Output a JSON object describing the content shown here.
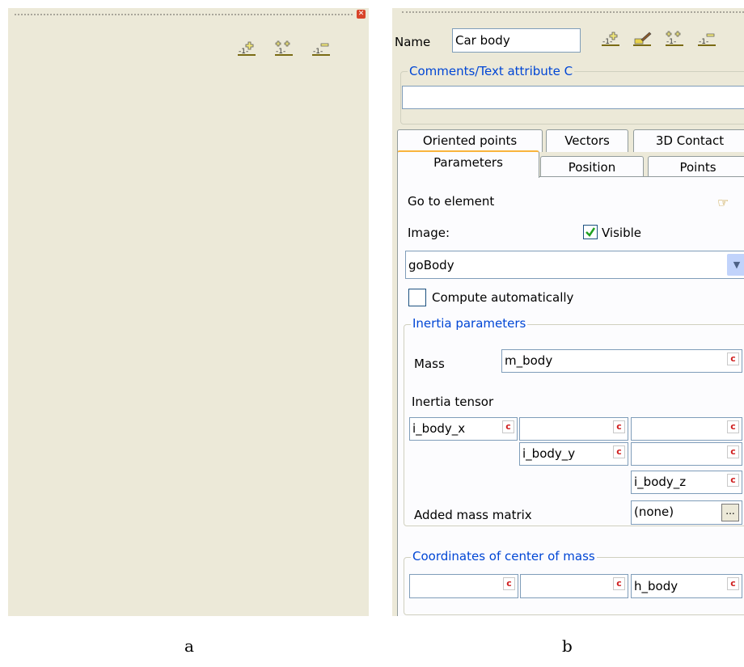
{
  "panel_a": {
    "icons": [
      "add-element-icon",
      "add-multiple-icon",
      "remove-element-icon"
    ]
  },
  "panel_b": {
    "name_label": "Name",
    "name_value": "Car body",
    "icons": [
      "add-element-icon",
      "edit-brush-icon",
      "add-multiple-icon",
      "remove-element-icon"
    ],
    "comments_title": "Comments/Text attribute C",
    "comments_value": "",
    "tabs_row1": [
      "Oriented points",
      "Vectors",
      "3D Contact"
    ],
    "tabs_row2": [
      "Parameters",
      "Position",
      "Points"
    ],
    "active_tab": "Parameters",
    "go_to_element": "Go to element",
    "image_label": "Image:",
    "visible_label": "Visible",
    "visible_checked": true,
    "image_select_value": "goBody",
    "compute_auto_label": "Compute automatically",
    "compute_auto_checked": false,
    "inertia_title": "Inertia parameters",
    "mass_label": "Mass",
    "mass_value": "m_body",
    "inertia_tensor_label": "Inertia tensor",
    "tensor": {
      "xx": "i_body_x",
      "xy": "",
      "xz": "",
      "yy": "i_body_y",
      "yz": "",
      "zz": "i_body_z"
    },
    "added_mass_label": "Added mass matrix",
    "added_mass_value": "(none)",
    "ellipsis": "...",
    "com_title": "Coordinates of center of mass",
    "com": [
      "",
      "",
      "h_body"
    ],
    "c_label": "c"
  },
  "captions": {
    "a": "a",
    "b": "b"
  },
  "colors": {
    "panel_bg": "#ece9d8",
    "group_title": "#0046d5",
    "c_button": "#d02020",
    "check": "#21a121"
  }
}
